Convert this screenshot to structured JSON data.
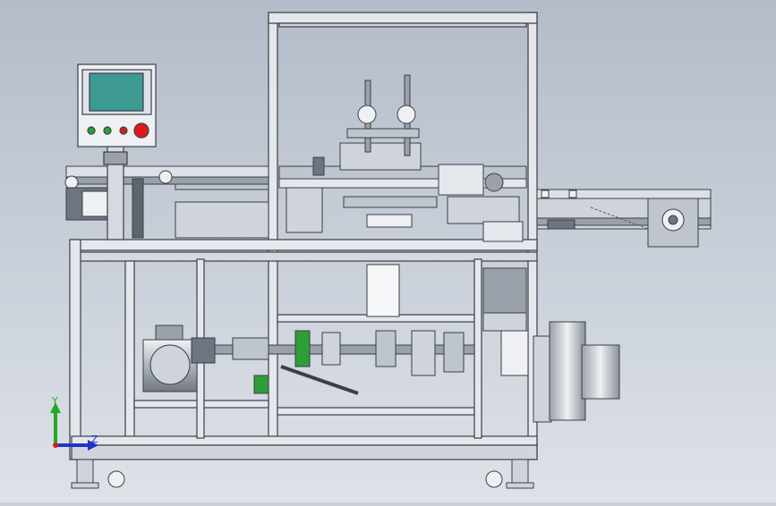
{
  "viewport": {
    "background_top": "#b3bcc9",
    "background_bottom": "#dee2e8"
  },
  "triad": {
    "y_label": "Y",
    "z_label": "Z",
    "y_color": "#22aa22",
    "z_color": "#2233cc",
    "origin_color": "#cc2222"
  },
  "colors": {
    "frame_fill": "#e4e7ec",
    "frame_edge": "#3a3f47",
    "metal_dark": "#6e7580",
    "metal_mid": "#9aa1ab",
    "hmi_screen": "#3c9a92",
    "hmi_body": "#eef0f3",
    "button_green": "#2e9e3a",
    "button_red": "#d21f1f",
    "button_estop": "#e01818",
    "white_block": "#f6f7f9"
  }
}
